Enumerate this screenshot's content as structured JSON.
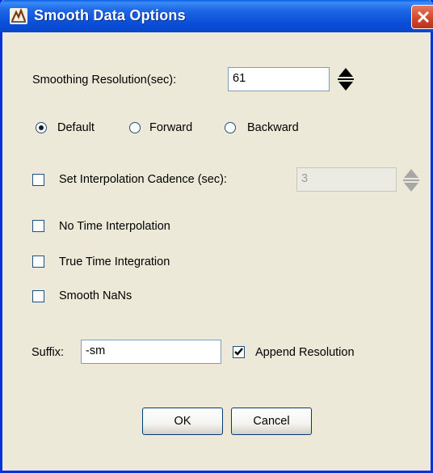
{
  "window": {
    "title": "Smooth Data Options"
  },
  "smoothing": {
    "label": "Smoothing Resolution(sec):",
    "value": "61"
  },
  "direction": {
    "options": [
      {
        "label": "Default",
        "selected": true
      },
      {
        "label": "Forward",
        "selected": false
      },
      {
        "label": "Backward",
        "selected": false
      }
    ]
  },
  "interpolation": {
    "label": "Set Interpolation Cadence (sec):",
    "checked": false,
    "value": "3",
    "enabled": false
  },
  "no_time_interp": {
    "label": "No Time Interpolation",
    "checked": false
  },
  "true_time_integ": {
    "label": "True Time Integration",
    "checked": false
  },
  "smooth_nans": {
    "label": "Smooth NaNs",
    "checked": false
  },
  "suffix": {
    "label": "Suffix:",
    "value": "-sm"
  },
  "append_resolution": {
    "label": "Append Resolution",
    "checked": true
  },
  "buttons": {
    "ok": "OK",
    "cancel": "Cancel"
  },
  "colors": {
    "titlebar": "#0a4fd9",
    "face": "#ece9d8",
    "close": "#d0452a"
  },
  "icons": {
    "app": "smooth-app-icon",
    "close": "close-icon",
    "spinner": "spinner-arrows-icon",
    "check": "checkmark-icon"
  }
}
